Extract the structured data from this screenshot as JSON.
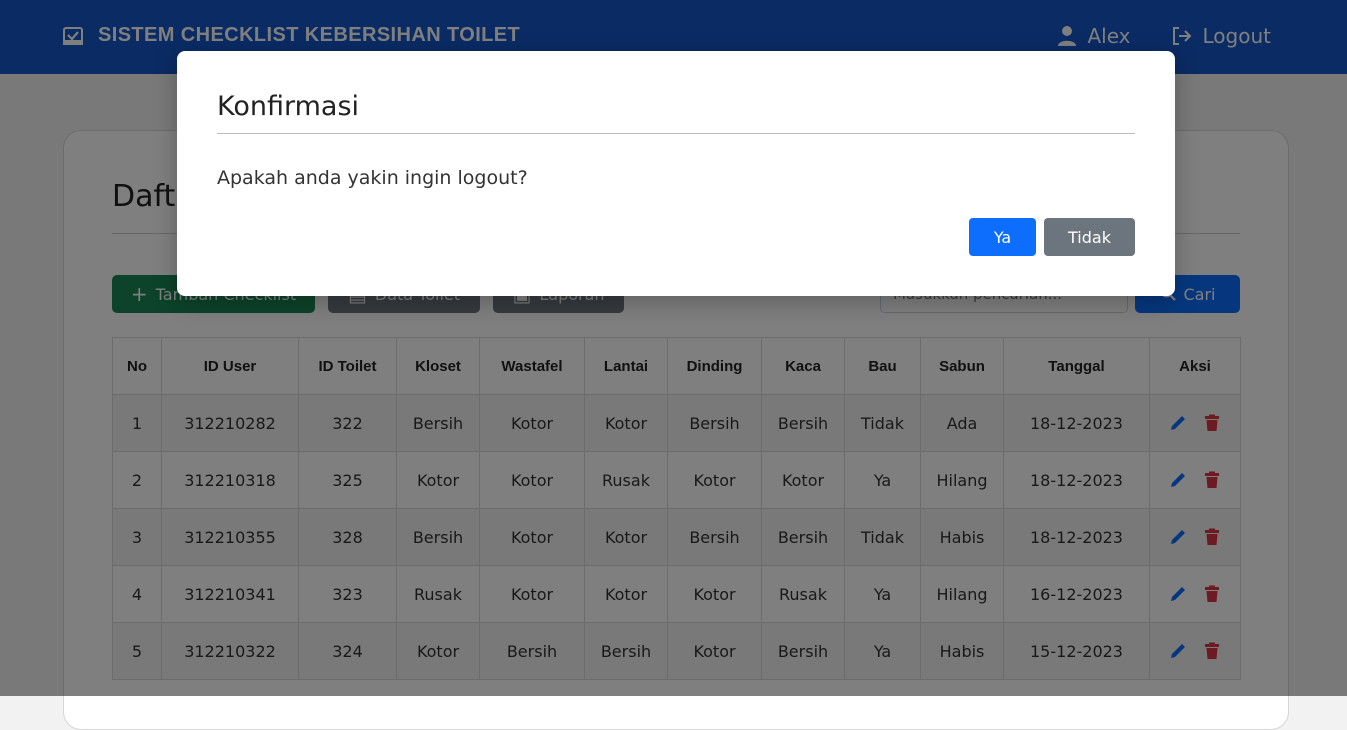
{
  "navbar": {
    "brand_title": "SISTEM CHECKLIST KEBERSIHAN TOILET",
    "user_name": "Alex",
    "logout_label": "Logout",
    "bg_color": "#1457c9"
  },
  "main": {
    "page_title": "Daftar Checklist",
    "buttons": {
      "add_label": "Tambah Checklist",
      "data_toilet_label": "Data Toilet",
      "laporan_label": "Laporan",
      "search_label": "Cari"
    },
    "search": {
      "placeholder": "Masukkan pencarian..."
    }
  },
  "table": {
    "headers": [
      "No",
      "ID User",
      "ID Toilet",
      "Kloset",
      "Wastafel",
      "Lantai",
      "Dinding",
      "Kaca",
      "Bau",
      "Sabun",
      "Tanggal",
      "Aksi"
    ],
    "rows": [
      [
        "1",
        "312210282",
        "322",
        "Bersih",
        "Kotor",
        "Kotor",
        "Bersih",
        "Bersih",
        "Tidak",
        "Ada",
        "18-12-2023"
      ],
      [
        "2",
        "312210318",
        "325",
        "Kotor",
        "Kotor",
        "Rusak",
        "Kotor",
        "Kotor",
        "Ya",
        "Hilang",
        "18-12-2023"
      ],
      [
        "3",
        "312210355",
        "328",
        "Bersih",
        "Kotor",
        "Kotor",
        "Bersih",
        "Bersih",
        "Tidak",
        "Habis",
        "18-12-2023"
      ],
      [
        "4",
        "312210341",
        "323",
        "Rusak",
        "Kotor",
        "Kotor",
        "Kotor",
        "Rusak",
        "Ya",
        "Hilang",
        "16-12-2023"
      ],
      [
        "5",
        "312210322",
        "324",
        "Kotor",
        "Bersih",
        "Bersih",
        "Kotor",
        "Bersih",
        "Ya",
        "Habis",
        "15-12-2023"
      ]
    ]
  },
  "modal": {
    "title": "Konfirmasi",
    "message": "Apakah anda yakin ingin logout?",
    "confirm_label": "Ya",
    "cancel_label": "Tidak"
  },
  "colors": {
    "primary": "#0d6efd",
    "success": "#198754",
    "secondary": "#6c757d",
    "danger": "#dc3545"
  }
}
